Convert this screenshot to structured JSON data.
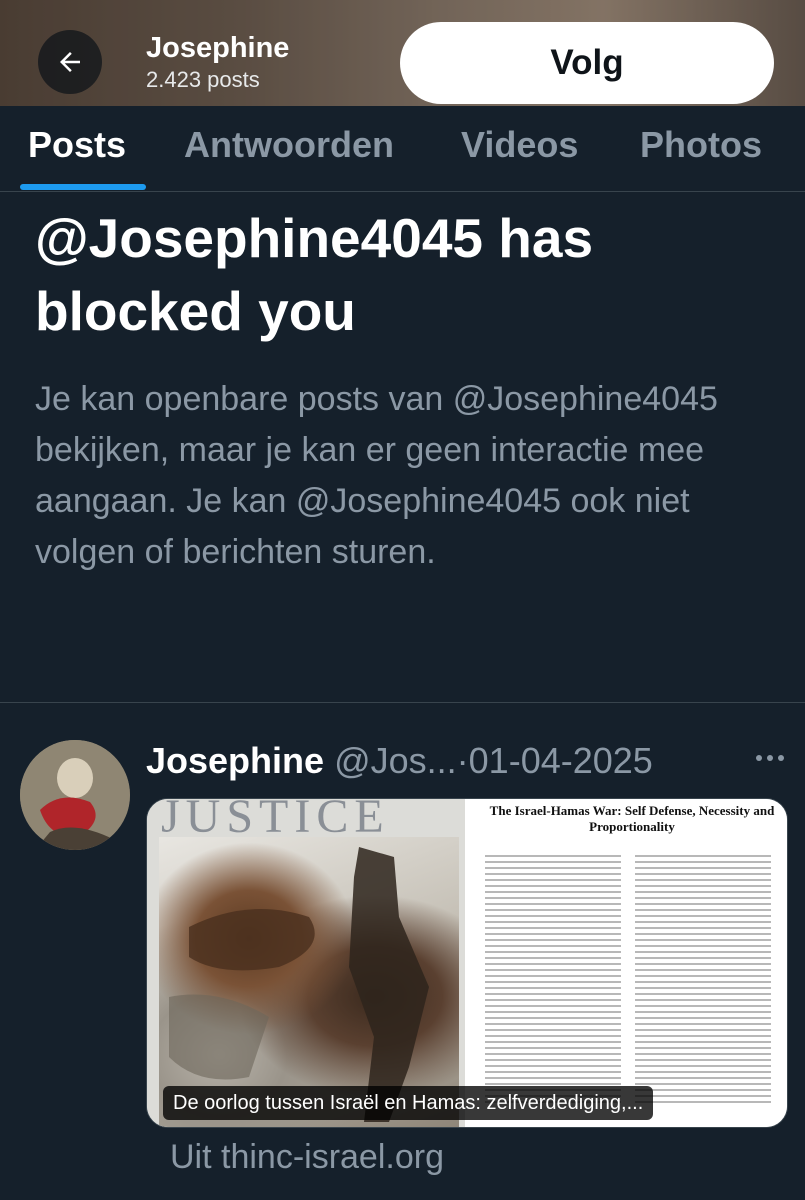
{
  "header": {
    "name": "Josephine",
    "post_count": "2.423 posts",
    "follow_label": "Volg"
  },
  "tabs": [
    {
      "label": "Posts",
      "active": true
    },
    {
      "label": "Antwoorden",
      "active": false
    },
    {
      "label": "Videos",
      "active": false
    },
    {
      "label": "Photos",
      "active": false
    }
  ],
  "blocked": {
    "title": "@Josephine4045 has blocked you",
    "body": "Je kan openbare posts van @Josephine4045 bekijken, maar je kan er geen interactie mee aangaan. Je kan @Josephine4045 ook niet volgen of berichten sturen."
  },
  "post": {
    "author": "Josephine",
    "handle": "@Jos...",
    "separator": "·",
    "date": "01-04-2025",
    "media": {
      "left_masthead": "JUSTICE",
      "doc_title": "The Israel-Hamas War: Self Defense, Necessity and Proportionality",
      "caption": "De oorlog tussen Israël en Hamas: zelfverdediging,..."
    },
    "source": "Uit thinc-israel.org"
  },
  "colors": {
    "background": "#15202b",
    "accent": "#1d9bf0",
    "muted_text": "#8b98a5",
    "follow_button_bg": "#ffffff"
  },
  "icons": {
    "back": "arrow-left-icon",
    "more": "more-horizontal-icon"
  }
}
